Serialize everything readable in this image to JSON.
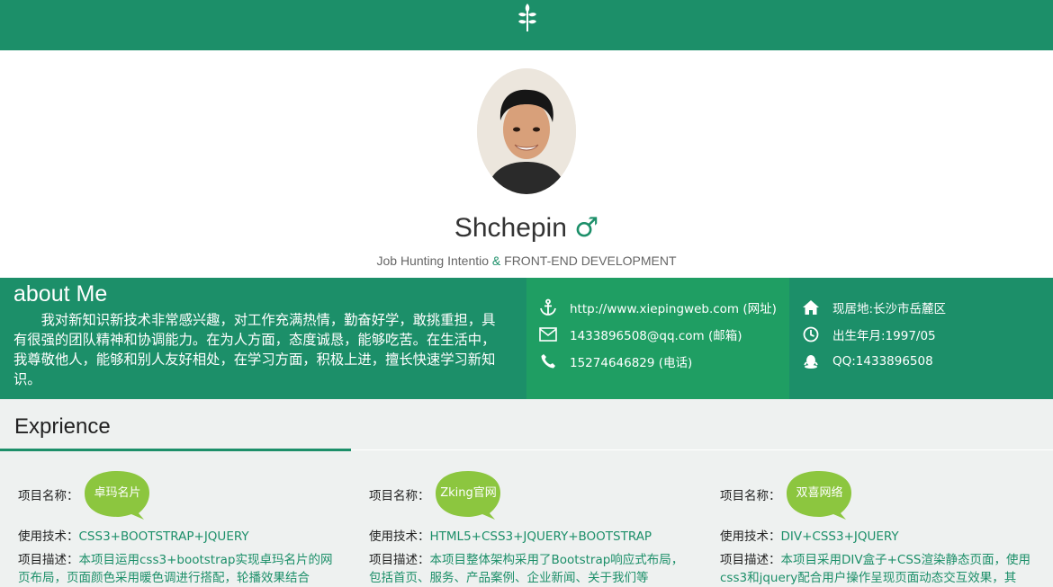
{
  "header": {
    "logo_icon": "leaf-icon"
  },
  "profile": {
    "name": "Shchepin",
    "gender_symbol": "♂",
    "intent_label": "Job Hunting Intentio",
    "amp": "&",
    "intent_value": "FRONT-END DEVELOPMENT"
  },
  "about": {
    "title": "about Me",
    "text": "我对新知识新技术非常感兴趣，对工作充满热情，勤奋好学，敢挑重担，具有很强的团队精神和协调能力。在为人方面，态度诚恳，能够吃苦。在生活中，我尊敬他人，能够和别人友好相处，在学习方面，积极上进，擅长快速学习新知识。"
  },
  "contact": {
    "website": "http://www.xiepingweb.com (网址)",
    "email": "1433896508@qq.com (邮箱)",
    "phone": "15274646829 (电话)"
  },
  "personal": {
    "residence": "现居地:长沙市岳麓区",
    "birth": "出生年月:1997/05",
    "qq": "QQ:1433896508"
  },
  "experience": {
    "title": "Exprience",
    "name_label": "项目名称：",
    "tech_label": "使用技术：",
    "desc_label": "项目描述：",
    "projects": [
      {
        "name": "卓玛名片",
        "tech": "CSS3+BOOTSTRAP+JQUERY",
        "desc": "本项目运用css3+bootstrap实现卓玛名片的网页布局，页面颜色采用暖色调进行搭配，轮播效果结合"
      },
      {
        "name": "Zking官网",
        "tech": "HTML5+CSS3+JQUERY+BOOTSTRAP",
        "desc": "本项目整体架构采用了Bootstrap响应式布局，包括首页、服务、产品案例、企业新闻、关于我们等"
      },
      {
        "name": "双喜网络",
        "tech": "DIV+CSS3+JQUERY",
        "desc": "本项目采用DIV盒子+CSS渲染静态页面，使用css3和jquery配合用户操作呈现页面动态交互效果，其"
      }
    ]
  },
  "colors": {
    "brand": "#1c8f69",
    "contact_bg": "#1f9e63",
    "bubble": "#8cc63f"
  }
}
